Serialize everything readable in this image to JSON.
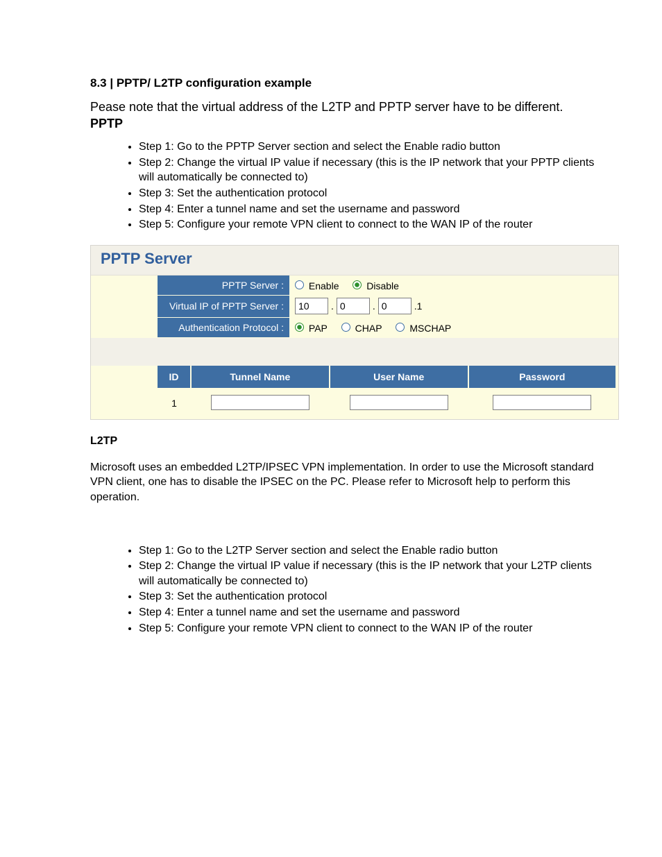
{
  "section_heading": "8.3 | PPTP/ L2TP configuration example",
  "note_text": "Pease note that the virtual address of the L2TP and PPTP server have to be different.",
  "pptp_heading": "PPTP",
  "pptp_steps": [
    "Step 1: Go to the PPTP Server section and select the Enable radio button",
    "Step 2: Change the virtual IP value if necessary (this is the IP network that your PPTP clients will automatically be connected to)",
    "Step 3: Set the authentication protocol",
    "Step 4: Enter a tunnel name and set the username and password",
    "Step 5: Configure your remote VPN client to connect to the WAN IP of the router"
  ],
  "panel": {
    "title": "PPTP Server",
    "rows": {
      "server_label": "PPTP Server :",
      "server_options": {
        "enable": "Enable",
        "disable": "Disable",
        "selected": "disable"
      },
      "vip_label": "Virtual IP of PPTP Server :",
      "vip_octets": [
        "10",
        "0",
        "0"
      ],
      "vip_suffix": ".1",
      "auth_label": "Authentication Protocol :",
      "auth_options": {
        "pap": "PAP",
        "chap": "CHAP",
        "mschap": "MSCHAP",
        "selected": "pap"
      }
    },
    "tunnel_headers": {
      "id": "ID",
      "name": "Tunnel Name",
      "user": "User Name",
      "pass": "Password"
    },
    "tunnel_row": {
      "id": "1",
      "name": "",
      "user": "",
      "pass": ""
    }
  },
  "l2tp_heading": "L2TP",
  "l2tp_para": "Microsoft uses an embedded L2TP/IPSEC VPN implementation. In order to use the Microsoft standard VPN client, one has to disable the IPSEC on the PC. Please refer to Microsoft help to perform this operation.",
  "l2tp_steps": [
    "Step 1: Go to the L2TP Server section and select the Enable radio button",
    "Step 2: Change the virtual IP value if necessary (this is the IP network that your L2TP clients will automatically be connected to)",
    "Step 3: Set the authentication protocol",
    "Step 4: Enter a tunnel name and set the username and password",
    "Step 5: Configure your remote VPN client to connect to the WAN IP of the router"
  ]
}
